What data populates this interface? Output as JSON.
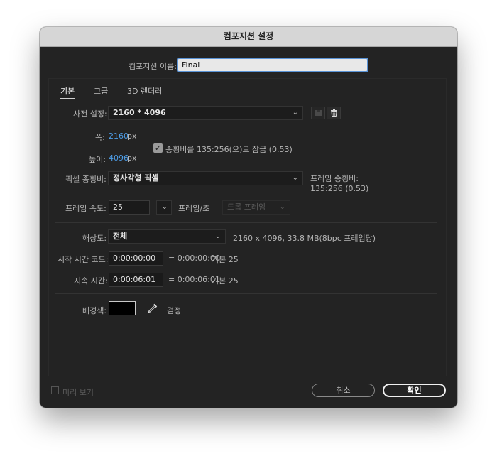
{
  "dialog": {
    "title": "컴포지션 설정"
  },
  "name": {
    "label": "컴포지션 이름:",
    "value": "Final"
  },
  "tabs": [
    {
      "label": "기본"
    },
    {
      "label": "고급"
    },
    {
      "label": "3D 렌더러"
    }
  ],
  "preset": {
    "label": "사전 설정:",
    "value": "2160 * 4096"
  },
  "width": {
    "label": "폭:",
    "value": "2160",
    "unit": "px"
  },
  "height": {
    "label": "높이:",
    "value": "4096",
    "unit": "px"
  },
  "lock_aspect": {
    "label": "종횡비를 135:256(으)로 잠금 (0.53)",
    "checked": true
  },
  "pixel_aspect": {
    "label": "픽셀 종횡비:",
    "value": "정사각형 픽셀"
  },
  "frame_aspect": {
    "label": "프레임 종횡비:",
    "value": "135:256 (0.53)"
  },
  "frame_rate": {
    "label": "프레임 속도:",
    "value": "25",
    "unit": "프레임/초",
    "drop_frame": "드롭 프레임"
  },
  "resolution": {
    "label": "해상도:",
    "value": "전체",
    "info": "2160 x 4096, 33.8 MB(8bpc 프레임당)"
  },
  "start_timecode": {
    "label": "시작 시간 코드:",
    "value": "0:00:00:00",
    "equals": "= 0:00:00:00",
    "base": "기본 25"
  },
  "duration": {
    "label": "지속 시간:",
    "value": "0:00:06:01",
    "equals": "= 0:00:06:01",
    "base": "기본 25"
  },
  "background": {
    "label": "배경색:",
    "color": "#000000",
    "color_name": "검정"
  },
  "footer": {
    "preview": "미리 보기",
    "cancel": "취소",
    "ok": "확인"
  }
}
